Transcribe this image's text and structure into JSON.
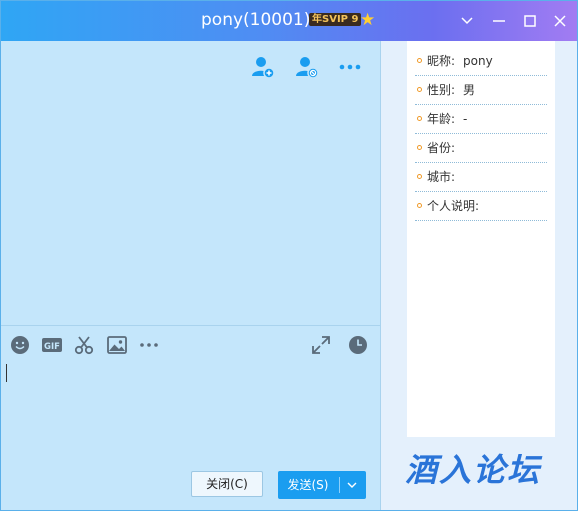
{
  "window": {
    "title": "pony(10001)",
    "vip_badge": "年SVIP 9",
    "star_icon": "star-icon",
    "controls": [
      "chevron-down-icon",
      "minimize-icon",
      "maximize-icon",
      "close-icon"
    ]
  },
  "chat": {
    "top_actions": [
      "add-friend-icon",
      "block-user-icon",
      "more-icon"
    ],
    "toolbar": [
      "emoji-icon",
      "gif-icon",
      "scissors-icon",
      "image-icon",
      "more-icon",
      "expand-icon",
      "history-clock-icon"
    ],
    "input_value": "",
    "buttons": {
      "close_label": "关闭(C)",
      "send_label": "发送(S)"
    }
  },
  "profile": {
    "rows": [
      {
        "label": "昵称:",
        "value": "pony"
      },
      {
        "label": "性别:",
        "value": "男"
      },
      {
        "label": "年龄:",
        "value": "-"
      },
      {
        "label": "省份:",
        "value": ""
      },
      {
        "label": "城市:",
        "value": ""
      },
      {
        "label": "个人说明:",
        "value": ""
      }
    ]
  },
  "watermark": "酒入论坛",
  "colors": {
    "title_gradient": [
      "#2fa6f4",
      "#a27cf2"
    ],
    "chat_bg": "#c4e6fb",
    "send_button": "#1a9df0",
    "icon": "#5a6b7a",
    "accent_icon": "#1a9df0"
  }
}
